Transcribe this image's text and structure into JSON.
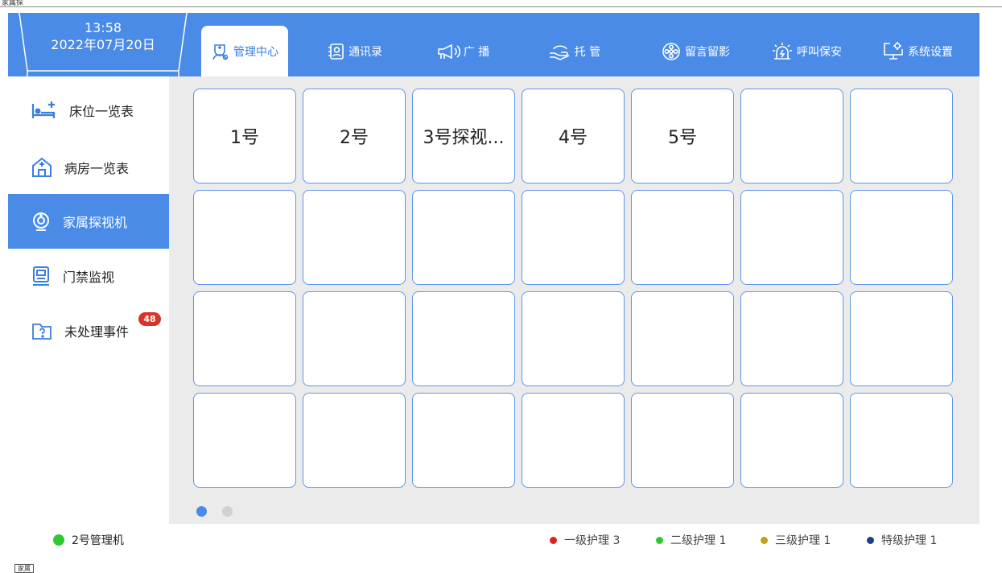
{
  "window_label": "家属探",
  "clock": {
    "time": "13:58",
    "date": "2022年07月20日"
  },
  "tabs": [
    {
      "label": "管理中心",
      "icon": "nurse-icon"
    },
    {
      "label": "通讯录",
      "icon": "contacts-icon"
    },
    {
      "label": "广  播",
      "icon": "megaphone-icon"
    },
    {
      "label": "托 管",
      "icon": "hand-icon"
    },
    {
      "label": "留言留影",
      "icon": "film-reel-icon"
    },
    {
      "label": "呼叫保安",
      "icon": "alarm-icon"
    },
    {
      "label": "系统设置",
      "icon": "monitor-gear-icon"
    }
  ],
  "sidebar": {
    "items": [
      {
        "label": "床位一览表",
        "icon": "bed-icon"
      },
      {
        "label": "病房一览表",
        "icon": "ward-icon"
      },
      {
        "label": "家属探视机",
        "icon": "camera-icon"
      },
      {
        "label": "门禁监视",
        "icon": "door-monitor-icon"
      },
      {
        "label": "未处理事件",
        "icon": "folder-question-icon"
      }
    ],
    "badge": "48"
  },
  "grid": {
    "cells": [
      "1号",
      "2号",
      "3号探视...",
      "4号",
      "5号",
      "",
      "",
      "",
      "",
      "",
      "",
      "",
      "",
      "",
      "",
      "",
      "",
      "",
      "",
      "",
      "",
      "",
      "",
      "",
      "",
      "",
      "",
      ""
    ]
  },
  "pager": {
    "current": 1,
    "total": 2
  },
  "status": {
    "label": "2号管理机",
    "color": "#2ec92e"
  },
  "legend": [
    {
      "label": "一级护理 3",
      "color": "#e02020"
    },
    {
      "label": "二级护理 1",
      "color": "#2ec92e"
    },
    {
      "label": "三级护理 1",
      "color": "#c0a020"
    },
    {
      "label": "特级护理 1",
      "color": "#1a3f8a"
    }
  ],
  "colors": {
    "primary": "#4a8be8",
    "cell_border": "#5e96ea",
    "background": "#ebebeb",
    "badge": "#d9342a"
  },
  "bottom_icon_label": "家属"
}
